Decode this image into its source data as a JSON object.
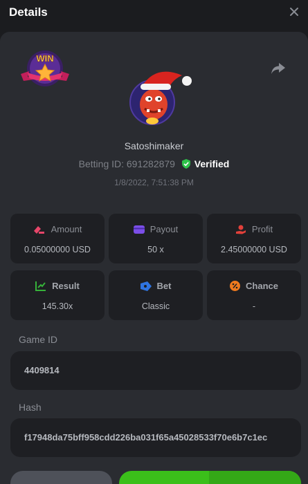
{
  "header": {
    "title": "Details"
  },
  "player": {
    "username": "Satoshimaker",
    "betting_id_text": "Betting ID: 691282879",
    "verified_text": "Verified",
    "datetime": "1/8/2022, 7:51:38 PM"
  },
  "badge": {
    "text": "WIN"
  },
  "stats": {
    "amount": {
      "label": "Amount",
      "value": "0.05000000 USD"
    },
    "payout": {
      "label": "Payout",
      "value": "50 x"
    },
    "profit": {
      "label": "Profit",
      "value": "2.45000000 USD"
    },
    "result": {
      "label": "Result",
      "value": "145.30x"
    },
    "bet": {
      "label": "Bet",
      "value": "Classic"
    },
    "chance": {
      "label": "Chance",
      "value": "-"
    }
  },
  "game_id": {
    "label": "Game ID",
    "value": "4409814"
  },
  "hash": {
    "label": "Hash",
    "value": "f17948da75bff958cdd226ba031f65a45028533f70e6b7c1ec"
  },
  "colors": {
    "background": "#1b1c1f",
    "panel": "#2a2c31",
    "card": "#1e1f23",
    "verified_green": "#2ec24a",
    "green_button": "#3bbf1a"
  },
  "icons": {
    "close": "close-icon",
    "share": "share-icon",
    "amount": "money-icon",
    "payout": "wallet-icon",
    "profit": "profit-hand-icon",
    "result": "chart-up-icon",
    "bet": "ticket-icon",
    "chance": "percent-icon",
    "verified": "shield-check-icon"
  }
}
